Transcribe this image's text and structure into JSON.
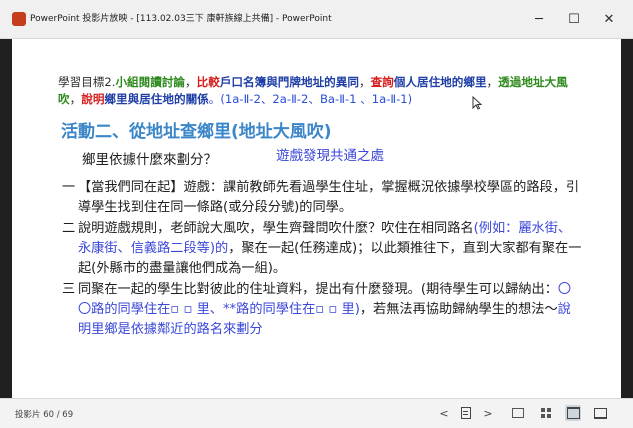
{
  "window": {
    "title": "PowerPoint 投影片放映 - [113.02.03三下 康軒族線上共備] - PowerPoint"
  },
  "icons": {
    "app": "powerpoint-icon",
    "minimize": "minimize-icon",
    "maximize": "maximize-icon",
    "close": "close-icon",
    "prev": "previous-slide-icon",
    "menu": "slide-menu-icon",
    "next": "next-slide-icon",
    "normal": "normal-view-icon",
    "sorter": "slide-sorter-icon",
    "reading": "reading-view-icon",
    "slideshow": "slideshow-view-icon",
    "cursor": "mouse-cursor-icon"
  },
  "window_controls": {
    "minimize": "─",
    "maximize": "☐",
    "close": "✕"
  },
  "slide": {
    "goal_segments": [
      {
        "text": "學習目標2.",
        "style": "plain"
      },
      {
        "text": "小組閱讀討論",
        "style": "green"
      },
      {
        "text": "，",
        "style": "plain"
      },
      {
        "text": "比較",
        "style": "red"
      },
      {
        "text": "戶口名簿與門牌地址的異同",
        "style": "navy"
      },
      {
        "text": "，",
        "style": "plain"
      },
      {
        "text": "查詢",
        "style": "red"
      },
      {
        "text": "個人居住地的鄉里",
        "style": "navy"
      },
      {
        "text": "，",
        "style": "plain"
      },
      {
        "text": "透過地址大風吹",
        "style": "green"
      },
      {
        "text": "，",
        "style": "plain"
      },
      {
        "text": "說明",
        "style": "red"
      },
      {
        "text": "鄉里與居住地的關係",
        "style": "navy"
      },
      {
        "text": "。(1a-Ⅱ-2、2a-Ⅱ-2、Ba-Ⅱ-1 、1a-Ⅱ-1)",
        "style": "blue"
      }
    ],
    "heading": "活動二、從地址查鄉里(地址大風吹)",
    "question": "鄉里依據什麼來劃分？",
    "game_note": "遊戲發現共通之處",
    "steps": [
      {
        "num": "一",
        "parts": [
          {
            "text": "【當我們同在起】遊戲：課前教師先看過學生住址，掌握概況依據學校學區的路段，引導學生找到住在同一條路(或分段分號)的同學。",
            "style": "plain"
          }
        ]
      },
      {
        "num": "二",
        "parts": [
          {
            "text": "說明遊戲規則，老師說大風吹，學生齊聲問吹什麼？吹住在相同路名",
            "style": "plain"
          },
          {
            "text": "(例如：麗水街、永康街、信義路二段等)的",
            "style": "blue"
          },
          {
            "text": "，聚在一起(任務達成)；以此類推往下，直到大家都有聚在一起(外縣市的盡量讓他們成為一組)。",
            "style": "plain"
          }
        ]
      },
      {
        "num": "三",
        "parts": [
          {
            "text": "同聚在一起的學生比對彼此的住址資料，提出有什麼發現。(期待學生可以歸納出：",
            "style": "plain"
          },
          {
            "text": "〇〇路的同學住在▫ ▫ 里、**路的同學住在▫ ▫ 里)",
            "style": "blue"
          },
          {
            "text": "，若無法再協助歸納學生的想法～",
            "style": "plain"
          },
          {
            "text": "說明里鄉是依據鄰近的路名來劃分",
            "style": "blue"
          }
        ]
      }
    ]
  },
  "statusbar": {
    "slide_counter": "投影片 60 / 69",
    "prev": "<",
    "next": ">"
  }
}
